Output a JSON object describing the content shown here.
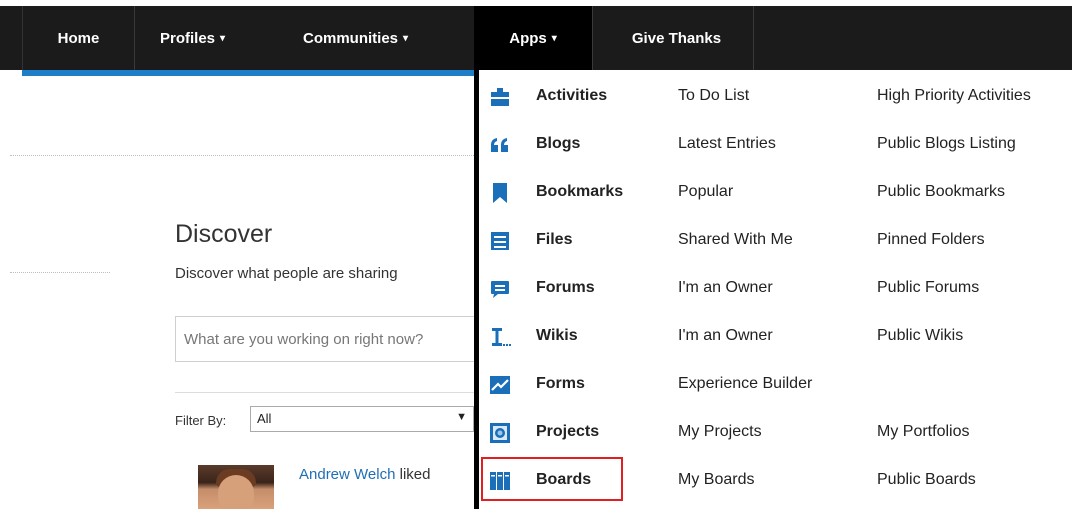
{
  "nav": {
    "home": "Home",
    "profiles": "Profiles",
    "communities": "Communities",
    "apps": "Apps",
    "give_thanks": "Give Thanks",
    "caret": "▾"
  },
  "page": {
    "title": "Discover",
    "subtitle": "Discover what people are sharing",
    "share_placeholder": "What are you working on right now?",
    "filter_label": "Filter By:",
    "filter_value": "All",
    "filter_arrow": "▼",
    "activity_user": "Andrew Welch",
    "activity_action": " liked"
  },
  "apps_menu": [
    {
      "icon": "briefcase-icon",
      "app": "Activities",
      "link1": "To Do List",
      "link2": "High Priority Activities"
    },
    {
      "icon": "quote-icon",
      "app": "Blogs",
      "link1": "Latest Entries",
      "link2": "Public Blogs Listing"
    },
    {
      "icon": "bookmark-icon",
      "app": "Bookmarks",
      "link1": "Popular",
      "link2": "Public Bookmarks"
    },
    {
      "icon": "file-cabinet-icon",
      "app": "Files",
      "link1": "Shared With Me",
      "link2": "Pinned Folders"
    },
    {
      "icon": "chat-bubble-icon",
      "app": "Forums",
      "link1": "I'm an Owner",
      "link2": "Public Forums"
    },
    {
      "icon": "text-cursor-icon",
      "app": "Wikis",
      "link1": "I'm an Owner",
      "link2": "Public Wikis"
    },
    {
      "icon": "trend-chart-icon",
      "app": "Forms",
      "link1": "Experience Builder",
      "link2": ""
    },
    {
      "icon": "target-square-icon",
      "app": "Projects",
      "link1": "My Projects",
      "link2": "My Portfolios"
    },
    {
      "icon": "board-columns-icon",
      "app": "Boards",
      "link1": "My Boards",
      "link2": "Public Boards"
    }
  ],
  "colors": {
    "nav_bg": "#1b1b1b",
    "accent": "#1e7fc7",
    "icon_blue": "#1a6fb8",
    "highlight": "#e02020"
  }
}
